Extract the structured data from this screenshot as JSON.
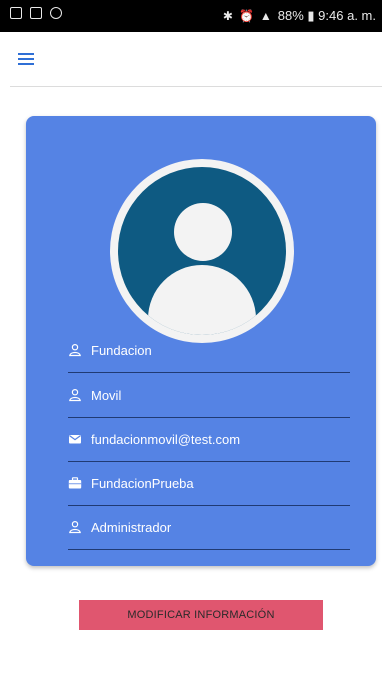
{
  "status_bar": {
    "text": "88% ▮ 9:46 a. m."
  },
  "user": {
    "first_name": "Fundacion",
    "last_name": "Movil",
    "email": "fundacionmovil@test.com",
    "organization": "FundacionPrueba",
    "role": "Administrador"
  },
  "actions": {
    "modify_label": "MODIFICAR INFORMACIÓN"
  },
  "colors": {
    "card": "#5583e4",
    "avatar": "#0e5a82",
    "button": "#e0566f",
    "menu": "#2f6fd6"
  },
  "icons": {
    "menu": "hamburger-icon",
    "first_name": "person-icon",
    "last_name": "person-icon",
    "email": "mail-icon",
    "organization": "briefcase-icon",
    "role": "person-icon"
  }
}
